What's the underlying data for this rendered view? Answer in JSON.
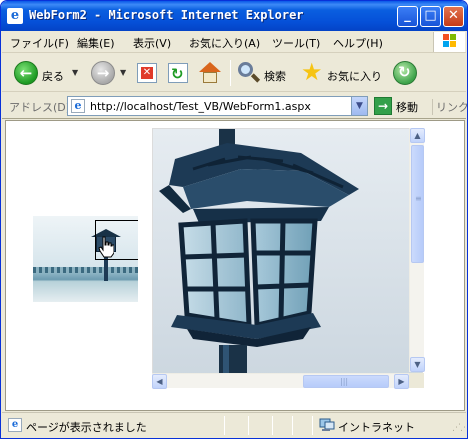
{
  "window": {
    "title": "WebForm2 - Microsoft Internet Explorer"
  },
  "titlebar_buttons": {
    "minimize": "_",
    "maximize": "□",
    "close": "✕"
  },
  "menu": {
    "items": [
      "ファイル(F)",
      "編集(E)",
      "表示(V)",
      "お気に入り(A)",
      "ツール(T)",
      "ヘルプ(H)"
    ]
  },
  "toolbar": {
    "back_label": "戻る",
    "search_label": "検索",
    "favorites_label": "お気に入り"
  },
  "address": {
    "label": "アドレス(D)",
    "url": "http://localhost/Test_VB/WebForm1.aspx",
    "go_label": "移動",
    "links_label": "リンク"
  },
  "status": {
    "text": "ページが表示されました",
    "zone": "イントラネット"
  },
  "colors": {
    "titlebar": "#0550d8",
    "chrome": "#ece9d8",
    "lantern_dark": "#1d3a55",
    "lantern_glass": "#9ec4d8"
  },
  "icons": {
    "back": "back-arrow-icon",
    "forward": "forward-arrow-icon",
    "stop": "stop-icon",
    "refresh": "refresh-icon",
    "home": "home-icon",
    "search": "search-icon",
    "favorites": "favorites-star-icon",
    "media": "media-icon",
    "go": "go-arrow-icon",
    "zone": "intranet-zone-icon"
  }
}
